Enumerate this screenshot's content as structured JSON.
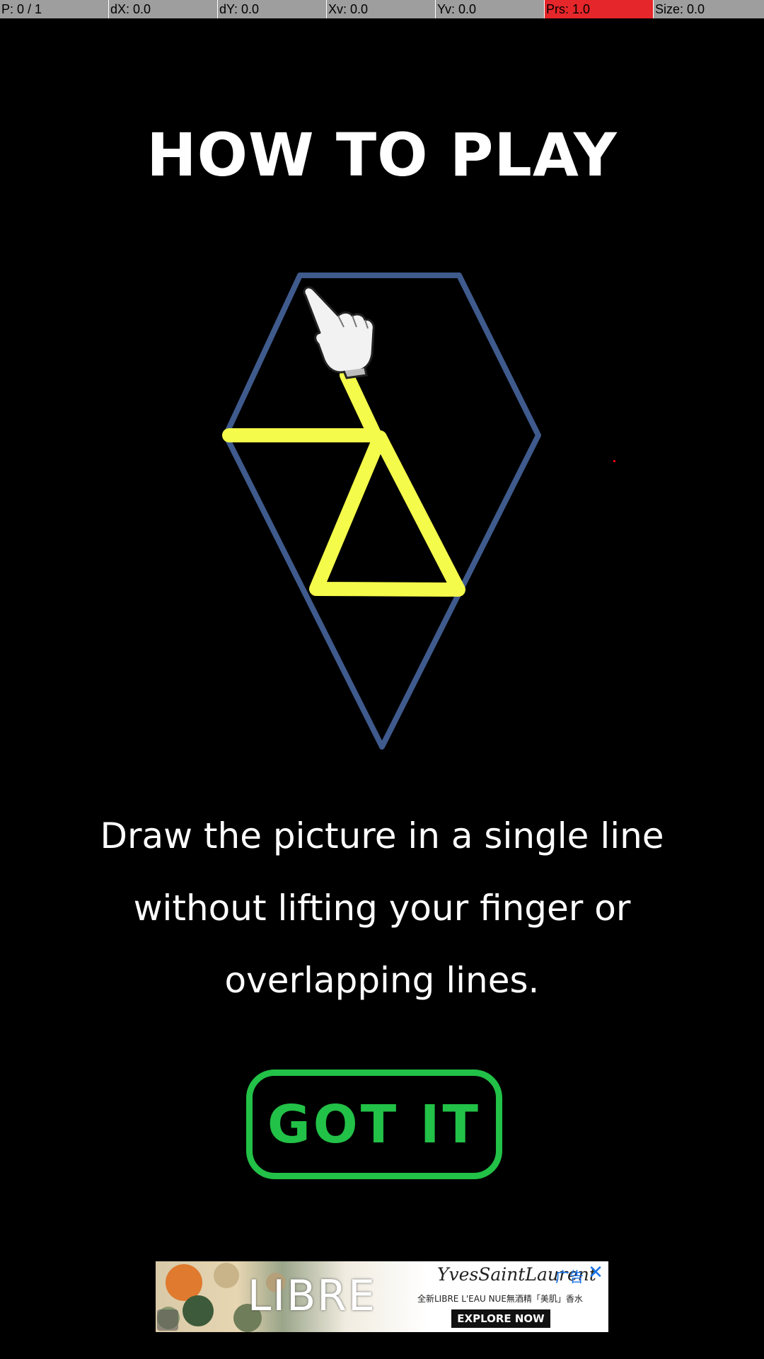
{
  "status_bar": {
    "pointer": "P: 0 / 1",
    "dx": "dX: 0.0",
    "dy": "dY: 0.0",
    "xv": "Xv: 0.0",
    "yv": "Yv: 0.0",
    "prs": "Prs: 1.0",
    "size": "Size: 0.0"
  },
  "title": "HOW TO PLAY",
  "instructions": {
    "line1": "Draw the picture in a single line",
    "line2": "without lifting your finger or",
    "line3": "overlapping lines."
  },
  "got_it_label": "GOT IT",
  "ad": {
    "brand": "LIBRE",
    "maker": "YvesSaintLaurent",
    "tag": "广告",
    "close": "✕",
    "description": "全新LIBRE L'EAU NUE無酒精「美肌」香水",
    "cta": "EXPLORE NOW"
  },
  "colors": {
    "background": "#000000",
    "outline": "#3f5a8c",
    "trace": "#f4fb4a",
    "accent_green": "#22c147",
    "status_alert": "#e5262a"
  },
  "icons": {
    "hand": "pointing-hand-icon",
    "ad_close": "close-icon",
    "ad_info": "info-icon"
  }
}
